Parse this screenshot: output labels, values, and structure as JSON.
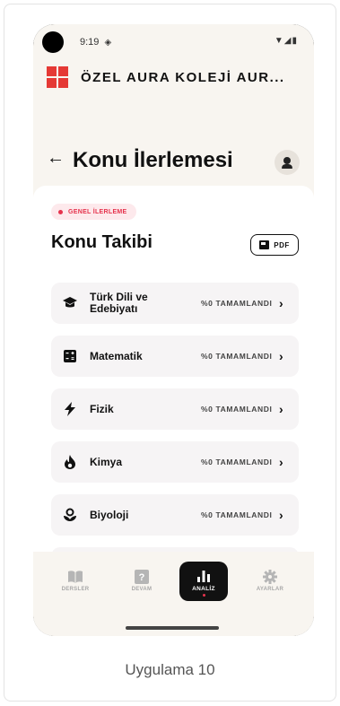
{
  "status": {
    "time": "9:19",
    "time_icon": "◈",
    "right_icons": "▼◢▮"
  },
  "school": {
    "name": "ÖZEL AURA KOLEJİ AUR..."
  },
  "header": {
    "title": "Konu İlerlemesi",
    "back_icon": "←"
  },
  "badge": {
    "label": "GENEL İLERLEME"
  },
  "section": {
    "title": "Konu Takibi",
    "pdf_label": "PDF"
  },
  "subjects": [
    {
      "name": "Türk Dili ve Edebiyatı",
      "progress": "%0 TAMAMLANDI",
      "icon": "graduation-cap-icon"
    },
    {
      "name": "Matematik",
      "progress": "%0 TAMAMLANDI",
      "icon": "calculator-icon"
    },
    {
      "name": "Fizik",
      "progress": "%0 TAMAMLANDI",
      "icon": "lightning-icon"
    },
    {
      "name": "Kimya",
      "progress": "%0 TAMAMLANDI",
      "icon": "flame-icon"
    },
    {
      "name": "Biyoloji",
      "progress": "%0 TAMAMLANDI",
      "icon": "bio-icon"
    }
  ],
  "chevron": "›",
  "nav": {
    "items": [
      {
        "label": "DERSLER",
        "icon": "book-icon"
      },
      {
        "label": "DEVAM",
        "icon": "quiz-icon"
      },
      {
        "label": "ANALİZ",
        "icon": "bar-chart-icon"
      },
      {
        "label": "AYARLAR",
        "icon": "gear-icon"
      }
    ]
  },
  "caption": "Uygulama 10",
  "colors": {
    "accent": "#e53935",
    "badge_text": "#e5334d",
    "background": "#f8f5f0"
  }
}
